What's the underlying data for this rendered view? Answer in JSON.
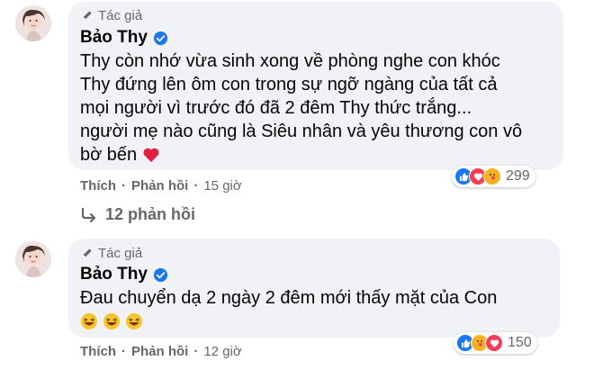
{
  "colors": {
    "bubble": "#f0f2f5",
    "secondary_text": "#65676b",
    "verified_blue": "#1877f2",
    "heart_red": "#e41e3f"
  },
  "comments": [
    {
      "author_tag": "Tác giả",
      "author_name": "Bảo Thy",
      "verified": true,
      "text_lines": [
        "Thy còn nhớ vừa sinh xong về phòng nghe con khóc",
        "Thy đứng lên ôm con trong sự ngỡ ngàng của tất cả",
        "mọi người vì trước đó đã 2 đêm Thy thức trắng...",
        "người mẹ nào cũng là Siêu nhân và yêu thương con vô",
        "bờ bến"
      ],
      "trailing_emoji": "heart-icon",
      "actions": {
        "like": "Thích",
        "reply": "Phản hồi",
        "time": "15 giờ"
      },
      "reactions": {
        "icons": [
          "like-icon",
          "love-icon",
          "care-icon"
        ],
        "count": "299"
      },
      "replies_link": "12 phản hồi"
    },
    {
      "author_tag": "Tác giả",
      "author_name": "Bảo Thy",
      "verified": true,
      "text_lines": [
        "Đau chuyển dạ 2 ngày 2 đêm mới thấy mặt của Con"
      ],
      "emojis": [
        "laughing-icon",
        "laughing-icon",
        "laughing-icon"
      ],
      "actions": {
        "like": "Thích",
        "reply": "Phản hồi",
        "time": "12 giờ"
      },
      "reactions": {
        "icons": [
          "like-icon",
          "care-icon",
          "love-icon"
        ],
        "count": "150"
      }
    }
  ]
}
